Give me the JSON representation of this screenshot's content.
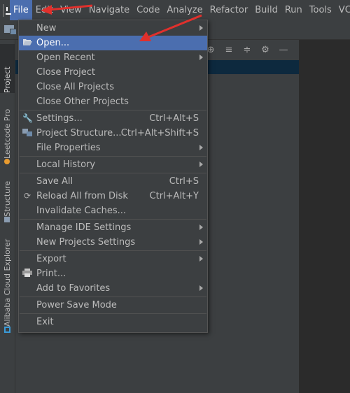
{
  "menubar": {
    "items": [
      "File",
      "Edit",
      "View",
      "Navigate",
      "Code",
      "Analyze",
      "Refactor",
      "Build",
      "Run",
      "Tools",
      "VC"
    ]
  },
  "sidebar": {
    "tabs": [
      "Project",
      "Leetcode Pro",
      "Structure",
      "Alibaba Cloud Explorer"
    ]
  },
  "file_menu": {
    "items": [
      {
        "label": "New",
        "shortcut": "",
        "submenu": true,
        "icon": ""
      },
      {
        "label": "Open...",
        "shortcut": "",
        "submenu": false,
        "icon": "folder-open-icon"
      },
      {
        "label": "Open Recent",
        "shortcut": "",
        "submenu": true,
        "icon": ""
      },
      {
        "label": "Close Project",
        "shortcut": "",
        "submenu": false,
        "icon": ""
      },
      {
        "label": "Close All Projects",
        "shortcut": "",
        "submenu": false,
        "icon": ""
      },
      {
        "label": "Close Other Projects",
        "shortcut": "",
        "submenu": false,
        "icon": ""
      },
      {
        "label": "Settings...",
        "shortcut": "Ctrl+Alt+S",
        "submenu": false,
        "icon": "wrench-icon"
      },
      {
        "label": "Project Structure...",
        "shortcut": "Ctrl+Alt+Shift+S",
        "submenu": false,
        "icon": "project-structure-icon"
      },
      {
        "label": "File Properties",
        "shortcut": "",
        "submenu": true,
        "icon": ""
      },
      {
        "label": "Local History",
        "shortcut": "",
        "submenu": true,
        "icon": ""
      },
      {
        "label": "Save All",
        "shortcut": "Ctrl+S",
        "submenu": false,
        "icon": "save-icon"
      },
      {
        "label": "Reload All from Disk",
        "shortcut": "Ctrl+Alt+Y",
        "submenu": false,
        "icon": "reload-icon"
      },
      {
        "label": "Invalidate Caches...",
        "shortcut": "",
        "submenu": false,
        "icon": ""
      },
      {
        "label": "Manage IDE Settings",
        "shortcut": "",
        "submenu": true,
        "icon": ""
      },
      {
        "label": "New Projects Settings",
        "shortcut": "",
        "submenu": true,
        "icon": ""
      },
      {
        "label": "Export",
        "shortcut": "",
        "submenu": true,
        "icon": ""
      },
      {
        "label": "Print...",
        "shortcut": "",
        "submenu": false,
        "icon": "print-icon"
      },
      {
        "label": "Add to Favorites",
        "shortcut": "",
        "submenu": true,
        "icon": ""
      },
      {
        "label": "Power Save Mode",
        "shortcut": "",
        "submenu": false,
        "icon": ""
      },
      {
        "label": "Exit",
        "shortcut": "",
        "submenu": false,
        "icon": ""
      }
    ]
  },
  "colors": {
    "accent": "#4b6eaf",
    "annotation": "#e0302c"
  }
}
